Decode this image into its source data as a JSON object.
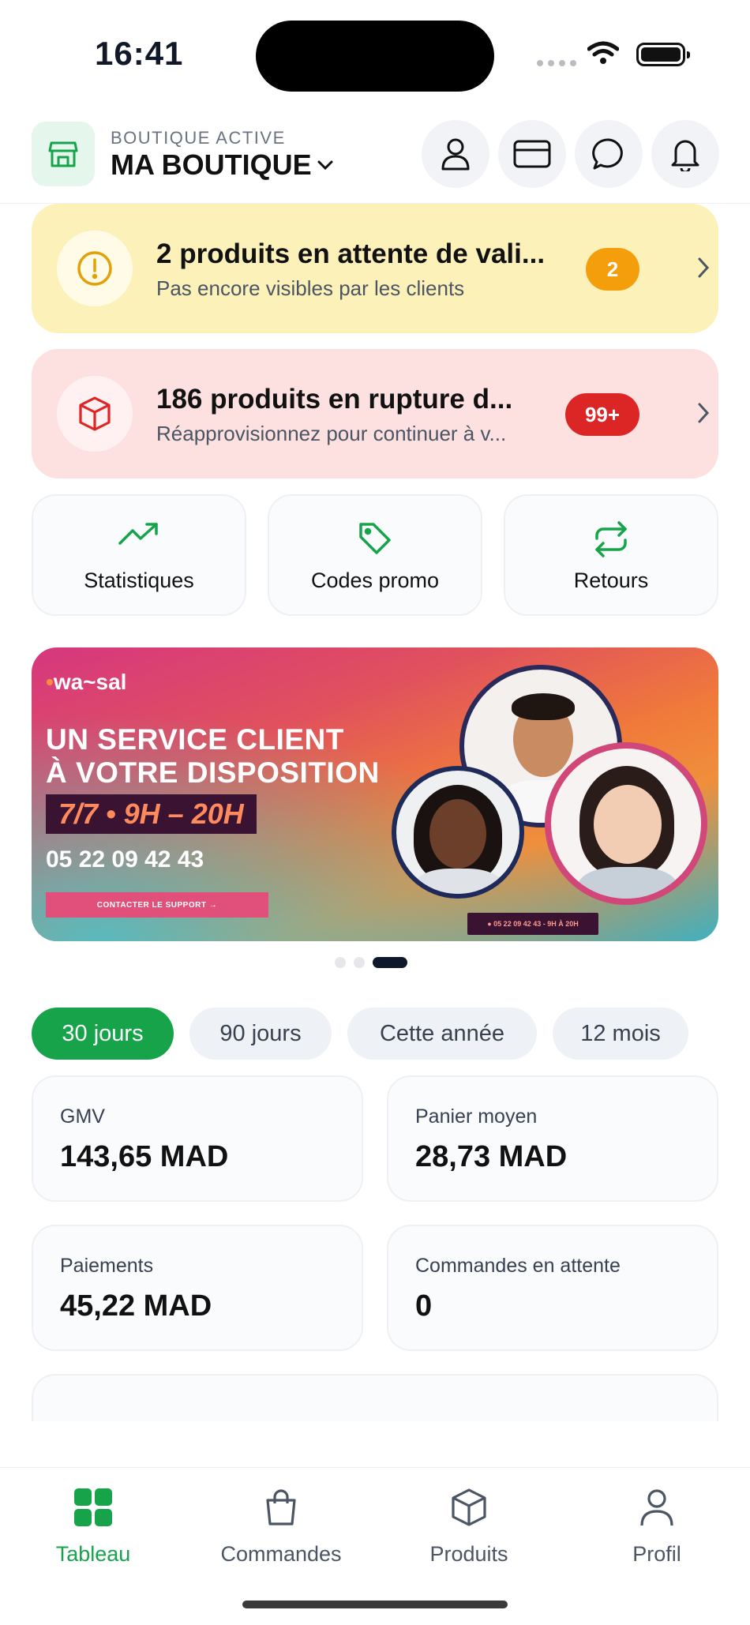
{
  "status_bar": {
    "time": "16:41"
  },
  "header": {
    "store_label": "BOUTIQUE ACTIVE",
    "store_name": "MA BOUTIQUE",
    "icons": [
      "store-icon",
      "user-icon",
      "card-icon",
      "chat-icon",
      "bell-icon"
    ]
  },
  "alerts": [
    {
      "title": "2 produits en attente de vali...",
      "subtitle": "Pas encore visibles par les clients",
      "badge": "2",
      "color": "#fcf1b8",
      "badge_color": "#f59e0b"
    },
    {
      "title": "186 produits en rupture d...",
      "subtitle": "Réapprovisionnez pour continuer à v...",
      "badge": "99+",
      "color": "#fde0e0",
      "badge_color": "#dc2626"
    }
  ],
  "quick_actions": [
    {
      "label": "Statistiques",
      "icon": "trending-up-icon"
    },
    {
      "label": "Codes promo",
      "icon": "tag-icon"
    },
    {
      "label": "Retours",
      "icon": "repeat-icon"
    }
  ],
  "banner": {
    "logo": "wa~sal",
    "headline_1": "UN SERVICE CLIENT",
    "headline_2": "À VOTRE DISPOSITION",
    "hours": "7/7 • 9H – 20H",
    "phone": "05 22 09 42 43",
    "cta": "CONTACTER LE SUPPORT →",
    "mini": "● 05 22 09 42 43 - 9H À 20H",
    "active_slide": 3,
    "slide_count": 3
  },
  "periods": [
    {
      "label": "30 jours",
      "selected": true
    },
    {
      "label": "90 jours",
      "selected": false
    },
    {
      "label": "Cette année",
      "selected": false
    },
    {
      "label": "12 mois",
      "selected": false
    }
  ],
  "stats": [
    {
      "label": "GMV",
      "value": "143,65 MAD"
    },
    {
      "label": "Panier moyen",
      "value": "28,73 MAD"
    },
    {
      "label": "Paiements",
      "value": "45,22 MAD"
    },
    {
      "label": "Commandes en attente",
      "value": "0"
    }
  ],
  "tabs": [
    {
      "label": "Tableau",
      "icon": "grid-icon",
      "active": true
    },
    {
      "label": "Commandes",
      "icon": "bag-icon",
      "active": false
    },
    {
      "label": "Produits",
      "icon": "box-icon",
      "active": false
    },
    {
      "label": "Profil",
      "icon": "user-icon",
      "active": false
    }
  ],
  "colors": {
    "accent": "#16a34a",
    "warning": "#f59e0b",
    "danger": "#dc2626"
  }
}
